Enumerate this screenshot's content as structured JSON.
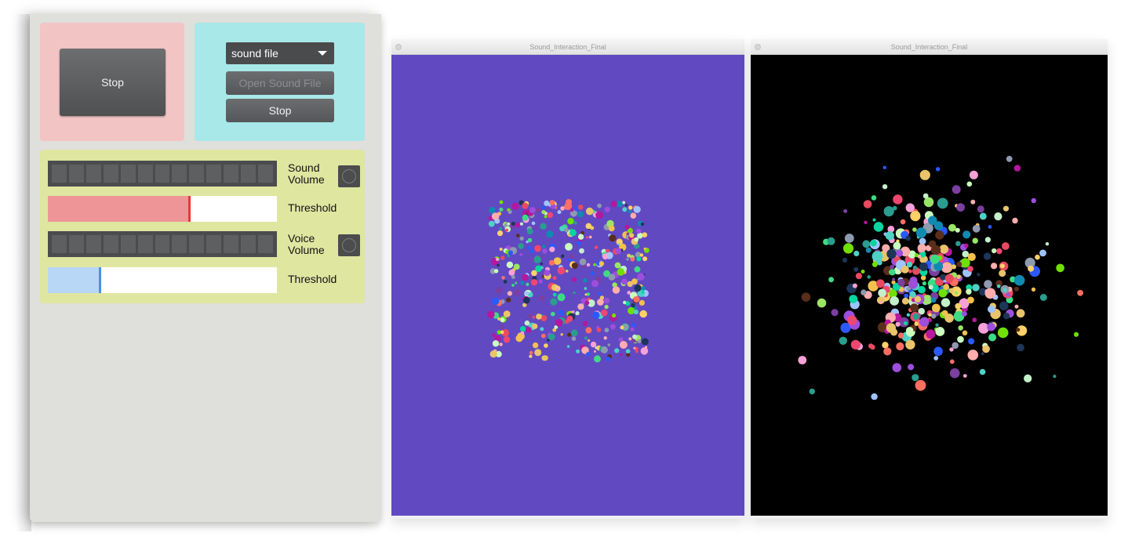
{
  "panel": {
    "pink_box": {
      "stop_label": "Stop"
    },
    "cyan_box": {
      "source_select": "sound file",
      "open_label": "Open Sound File",
      "stop_label": "Stop"
    },
    "controls": {
      "sound_volume_label_line1": "Sound",
      "sound_volume_label_line2": "Volume",
      "sound_threshold_label": "Threshold",
      "sound_threshold_level": 0.62,
      "voice_volume_label_line1": "Voice",
      "voice_volume_label_line2": "Volume",
      "voice_threshold_label": "Threshold",
      "voice_threshold_level": 0.23
    },
    "colors": {
      "pink": "#f3c4c4",
      "cyan": "#a8e8e8",
      "yellow": "#dfe6a0",
      "sound_threshold_fill": "#ee9597",
      "sound_threshold_knob": "#e53935",
      "voice_threshold_fill": "#b8d6f6",
      "voice_threshold_knob": "#4a90e2"
    }
  },
  "windows": [
    {
      "title": "Sound_Interaction_Final",
      "background": "#6149c2"
    },
    {
      "title": "Sound_Interaction_Final",
      "background": "#000000"
    }
  ]
}
